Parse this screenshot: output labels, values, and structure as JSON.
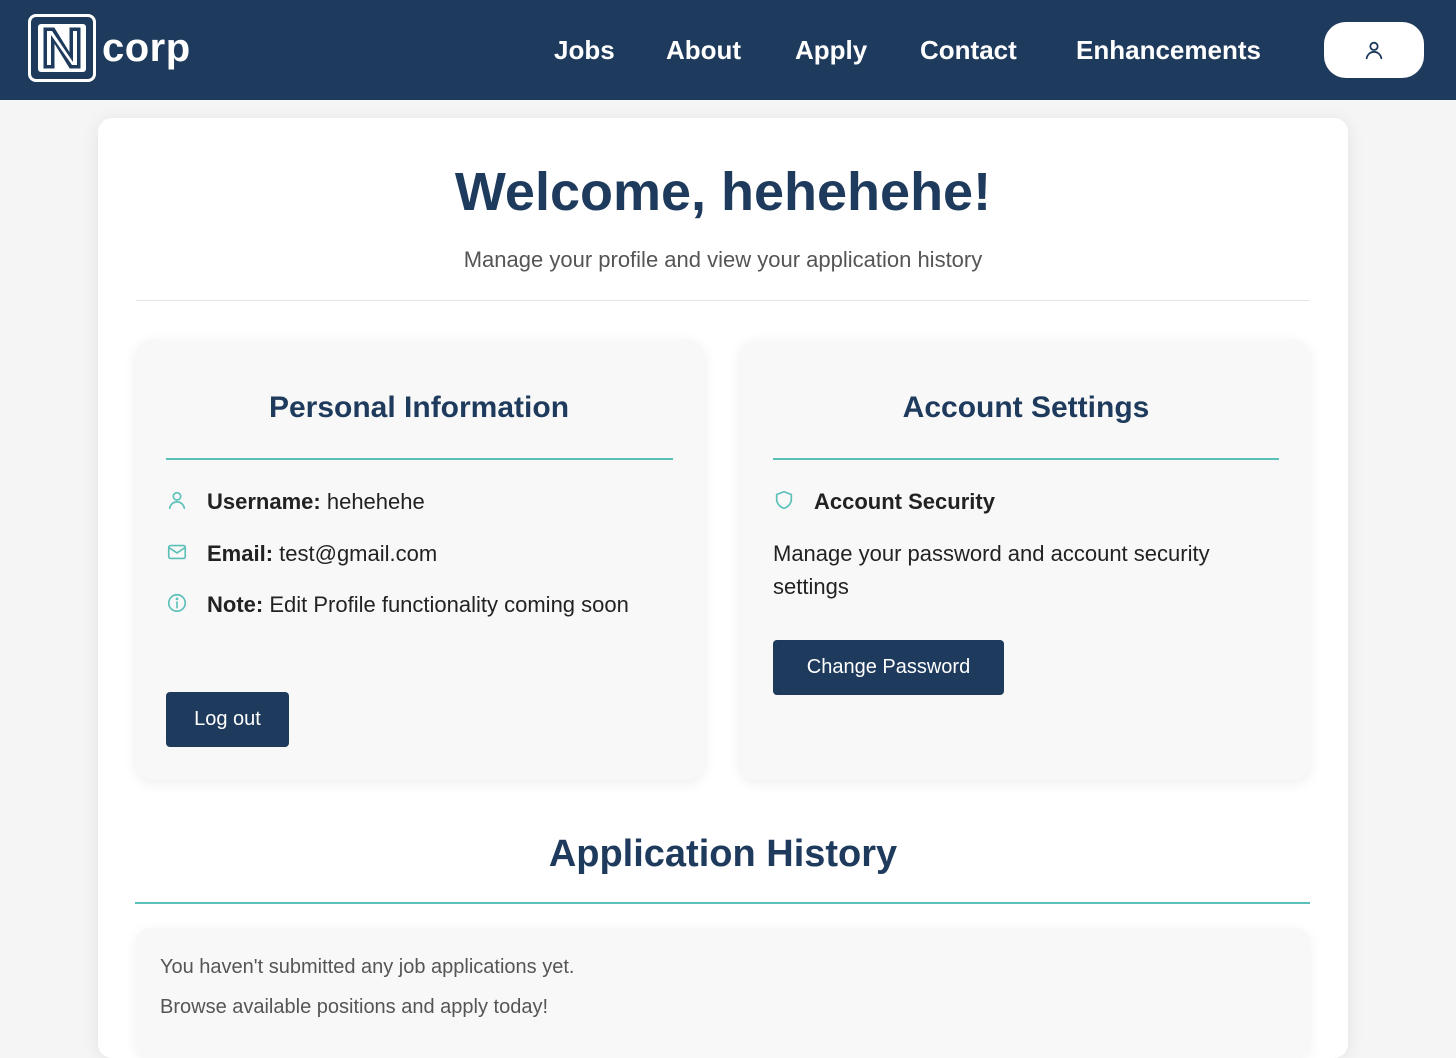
{
  "brand": {
    "logo_letter": "N",
    "logo_text": "corp"
  },
  "nav": {
    "links": [
      "Jobs",
      "About",
      "Apply",
      "Contact",
      "Enhancements"
    ],
    "profile_icon": "user-icon"
  },
  "header": {
    "welcome": "Welcome, hehehehe!",
    "subtitle": "Manage your profile and view your application history"
  },
  "personal": {
    "title": "Personal Information",
    "username_label": "Username:",
    "username_value": "hehehehe",
    "email_label": "Email:",
    "email_value": "test@gmail.com",
    "note_label": "Note:",
    "note_value": "Edit Profile functionality coming soon",
    "logout_label": "Log out"
  },
  "account": {
    "title": "Account Settings",
    "security_label": "Account Security",
    "security_desc": "Manage your password and account security settings",
    "change_password_label": "Change Password"
  },
  "history": {
    "title": "Application History",
    "empty_line1": "You haven't submitted any job applications yet.",
    "empty_line2": "Browse available positions and apply today!"
  },
  "colors": {
    "navy": "#1e3a5c",
    "teal": "#5bc0b8",
    "card": "#f8f8f8"
  }
}
